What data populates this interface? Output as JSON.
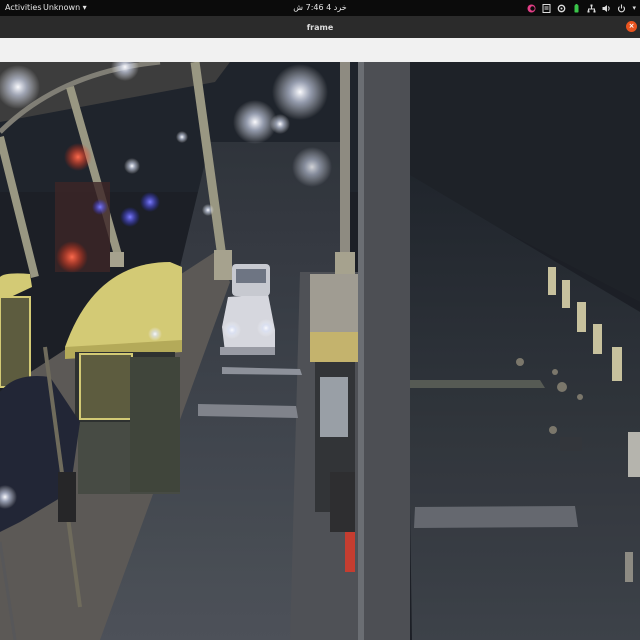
{
  "topbar": {
    "activities_label": "Activities",
    "app_menu_label": "Unknown",
    "clock_text": "خرد 4  7:46 ش"
  },
  "window": {
    "title": "frame",
    "close_glyph": "×"
  },
  "tray_icons": [
    "color-picker-icon",
    "document-icon",
    "settings-icon",
    "battery-icon",
    "network-icon",
    "volume-icon",
    "power-icon"
  ],
  "colors": {
    "accent": "#e9541f",
    "topbar_bg": "#0b0b0b",
    "titlebar_bg": "#2b2b2b",
    "toolbar_bg": "#f1f1f1"
  },
  "frame": {
    "description_icon": "camera-feed-image"
  }
}
